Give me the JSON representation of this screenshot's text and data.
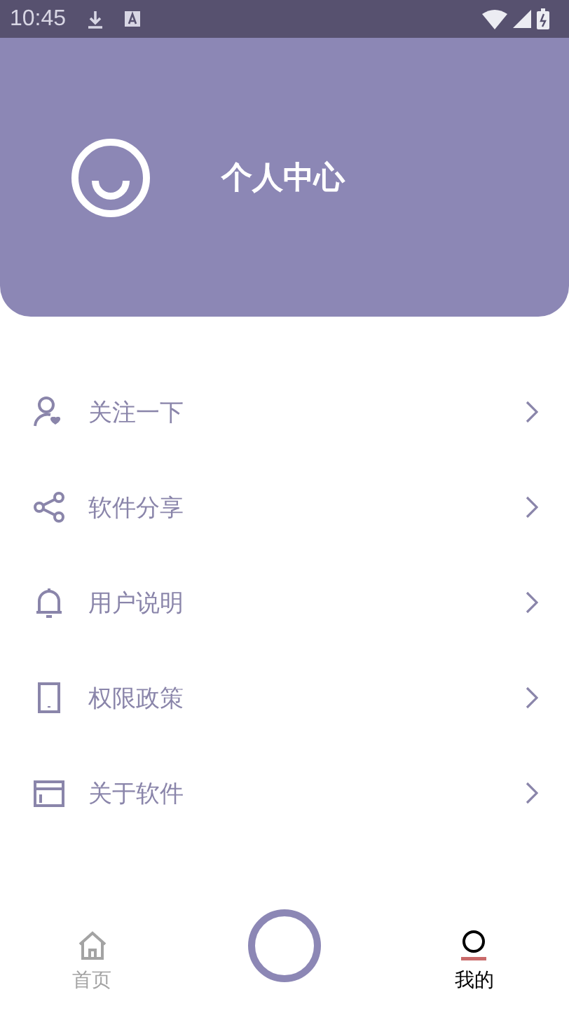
{
  "status_bar": {
    "time": "10:45"
  },
  "header": {
    "title": "个人中心"
  },
  "menu": [
    {
      "kind": "follow",
      "label": "关注一下"
    },
    {
      "kind": "share",
      "label": "软件分享"
    },
    {
      "kind": "bell",
      "label": "用户说明"
    },
    {
      "kind": "phone",
      "label": "权限政策"
    },
    {
      "kind": "window",
      "label": "关于软件"
    }
  ],
  "tabs": [
    {
      "kind": "home",
      "label": "首页",
      "selected": false
    },
    {
      "kind": "me",
      "label": "我的",
      "selected": true
    }
  ]
}
